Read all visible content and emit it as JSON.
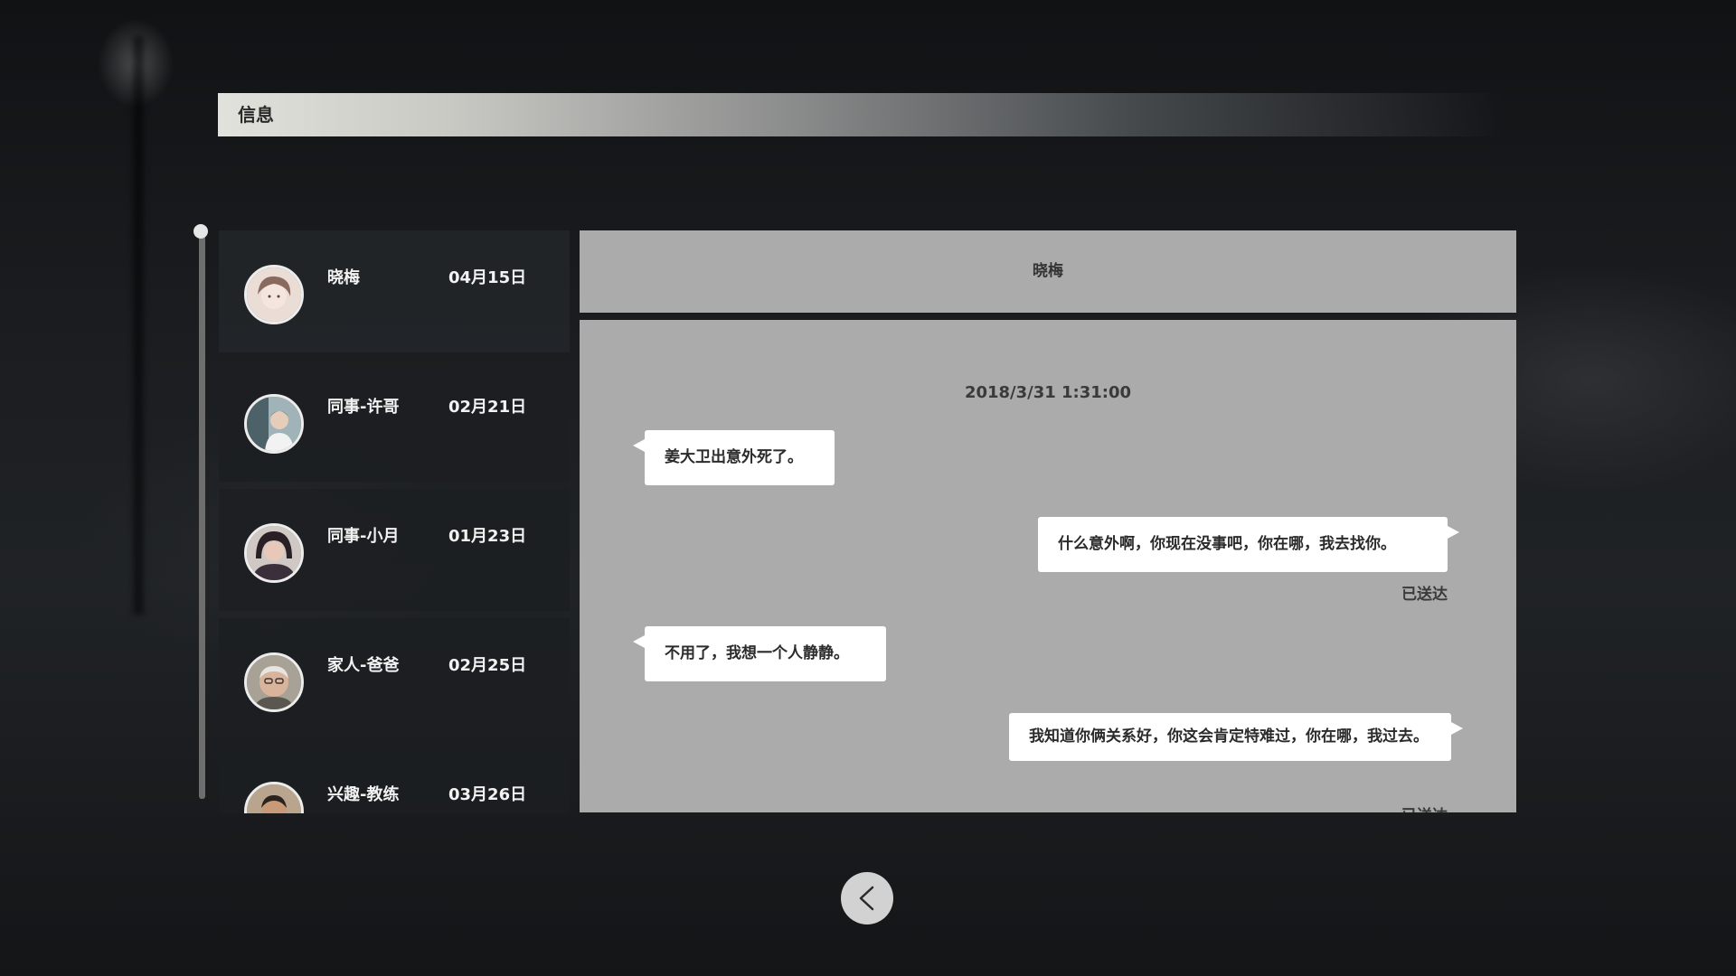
{
  "header": {
    "title": "信息"
  },
  "contacts": [
    {
      "name": "晓梅",
      "date": "04月15日",
      "avatar_icon": "avatar-woman-icon"
    },
    {
      "name": "同事-许哥",
      "date": "02月21日",
      "avatar_icon": "avatar-man-icon"
    },
    {
      "name": "同事-小月",
      "date": "01月23日",
      "avatar_icon": "avatar-woman-icon"
    },
    {
      "name": "家人-爸爸",
      "date": "02月25日",
      "avatar_icon": "avatar-older-man-icon"
    },
    {
      "name": "兴趣-教练",
      "date": "03月26日",
      "avatar_icon": "avatar-man-icon"
    }
  ],
  "chat": {
    "contact_name": "晓梅",
    "timestamp": "2018/3/31  1:31:00",
    "messages": [
      {
        "side": "left",
        "text": "姜大卫出意外死了。"
      },
      {
        "side": "right",
        "text": "什么意外啊，你现在没事吧，你在哪，我去找你。",
        "status": "已送达"
      },
      {
        "side": "left",
        "text": "不用了，我想一个人静静。"
      },
      {
        "side": "right",
        "text": "我知道你俩关系好，你这会肯定特难过，你在哪，我过去。",
        "status": "已送达"
      }
    ]
  },
  "icons": {
    "back": "back-arrow-icon"
  },
  "colors": {
    "panel": "#ababab",
    "bubble": "#ffffff",
    "list_bg": "#1c1e21"
  }
}
